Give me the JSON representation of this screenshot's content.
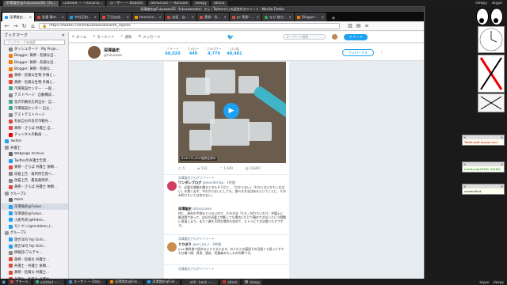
{
  "top_panel": {
    "tasks": [
      "深澤論史@FukuzawaSS（fukuzawasato）さん / Twitter - Mozilla Firefox",
      "untitled — ~/local-b...",
      "ユーザー — Dolphin",
      "tamachan — Konsole",
      "sleepy",
      "atlock"
    ],
    "right_items": [
      "sleepy",
      "skype"
    ]
  },
  "window": {
    "title": "深澤論史@FukuzawaSS（fukuzawasato）さん / Twitterからの返信付きツイート - Mozilla Firefox"
  },
  "tabs": [
    {
      "label": "深澤論史@Fukuza...",
      "color": "#1da1f2",
      "active": true
    },
    {
      "label": "急量 静の道 ...",
      "color": "#e3473a",
      "active": false
    },
    {
      "label": "中村元和@Fuk...",
      "color": "#1da1f2",
      "active": false
    },
    {
      "label": "下谷@成瀬研",
      "color": "#e3473a",
      "active": false
    },
    {
      "label": "tamachanブログ",
      "color": "#ff9900",
      "active": false
    },
    {
      "label": "自転 - 自転ダ...",
      "color": "#e3473a",
      "active": false
    },
    {
      "label": "黄柳 - 危険な...",
      "color": "#e3473a",
      "active": false
    },
    {
      "label": "pc 黄柳 - 危険...",
      "color": "#e3473a",
      "active": false
    },
    {
      "label": "なぜ 能力テスト",
      "color": "#34a853",
      "active": false
    },
    {
      "label": "Blogger: 黄柳...",
      "color": "#f57d00",
      "active": false
    }
  ],
  "navbar": {
    "url": "https://twitter.com/fukuzawasato/with_replies",
    "back": "←",
    "forward": "→",
    "reload": "↻",
    "home": "⌂"
  },
  "sidebar": {
    "title": "ブックマーク",
    "search_placeholder": "ブックマークを検索",
    "items": [
      {
        "label": "ダッシュボード · My Proje...",
        "indent": 2,
        "color": "#888"
      },
      {
        "label": "Blogger: 黄柳 - 危険な自...",
        "indent": 2,
        "color": "#f57d00"
      },
      {
        "label": "Blogger: 黄柳 - 危険な自...",
        "indent": 2,
        "color": "#f57d00"
      },
      {
        "label": "Blogger: 黄柳 - 危険な...",
        "indent": 2,
        "color": "#f57d00"
      },
      {
        "label": "黄柳 - 危険な生物 外傷と...",
        "indent": 2,
        "color": "#e3473a"
      },
      {
        "label": "黄柳 - 危険な生物 外傷と...",
        "indent": 2,
        "color": "#e3473a"
      },
      {
        "label": "市場施設センター · 一般...",
        "indent": 2,
        "color": "#4a8"
      },
      {
        "label": "テストページ · 自動構成...",
        "indent": 2,
        "color": "#888"
      },
      {
        "label": "金沢市観光応用自分 · 自...",
        "indent": 2,
        "color": "#4a8"
      },
      {
        "label": "市場施設センター 自立...",
        "indent": 2,
        "color": "#4a8"
      },
      {
        "label": "テストテストページ",
        "indent": 2,
        "color": "#888"
      },
      {
        "label": "有益自分の金沢市観光...",
        "indent": 2,
        "color": "#e3473a"
      },
      {
        "label": "黄柳 - さらば 弁護士 自...",
        "indent": 2,
        "color": "#e3473a"
      },
      {
        "label": "チャンネルの動画 · ...",
        "indent": 2,
        "color": "#e00"
      },
      {
        "label": "Twitter",
        "indent": 1,
        "color": "#1da1f2"
      },
      {
        "label": "弁護士",
        "indent": 1,
        "color": "#999"
      },
      {
        "label": "Webpage Archive",
        "indent": 2,
        "color": "#666"
      },
      {
        "label": "Twitterの弁護士告発...",
        "indent": 2,
        "color": "#1da1f2"
      },
      {
        "label": "黄柳 - さらば 弁護士 依頼...",
        "indent": 2,
        "color": "#e3473a"
      },
      {
        "label": "改竄上告 · 裁判所告発へ...",
        "indent": 2,
        "color": "#888"
      },
      {
        "label": "改竄上告 · 最高裁判所...",
        "indent": 2,
        "color": "#888"
      },
      {
        "label": "黄柳 - さらば 弁護士 依頼...",
        "indent": 2,
        "color": "#e3473a"
      },
      {
        "label": "グループ2",
        "indent": 1,
        "color": "#999"
      },
      {
        "label": "Atom",
        "indent": 2,
        "color": "#666"
      },
      {
        "label": "深澤論史@Fukuz...",
        "indent": 2,
        "color": "#1da1f2",
        "selected": true
      },
      {
        "label": "深澤論史@Fukuz...",
        "indent": 2,
        "color": "#1da1f2"
      },
      {
        "label": "小倉秀夫(@Hideo...",
        "indent": 2,
        "color": "#1da1f2"
      },
      {
        "label": "モトケン(@motoken_t...",
        "indent": 2,
        "color": "#1da1f2"
      },
      {
        "label": "グループ3",
        "indent": 1,
        "color": "#999"
      },
      {
        "label": "落合洋司 Yoji Ochi...",
        "indent": 2,
        "color": "#1da1f2"
      },
      {
        "label": "落合洋司 Yoji Ochi...",
        "indent": 2,
        "color": "#1da1f2"
      },
      {
        "label": "情報誌/フムテキ...",
        "indent": 2,
        "color": "#888"
      },
      {
        "label": "黄柳 - 危険な 弁護士...",
        "indent": 2,
        "color": "#e3473a"
      },
      {
        "label": "弁護士 - 弁護士 依頼...",
        "indent": 2,
        "color": "#e3473a"
      },
      {
        "label": "黄柳 - 危険な 弁護士...",
        "indent": 2,
        "color": "#e3473a"
      },
      {
        "label": "弁護士 - 危険な 弁護士...",
        "indent": 2,
        "color": "#e3473a"
      }
    ]
  },
  "twitter": {
    "nav": {
      "home": "ホーム",
      "moments": "モーメント",
      "notifications": "通知",
      "messages": "メッセージ",
      "search_placeholder": "キーワード検索",
      "tweet_button": "ツイート"
    },
    "profile": {
      "name": "深澤論史",
      "handle": "@fukuzawa",
      "stats": [
        {
          "label": "ツイート",
          "value": "60,020"
        },
        {
          "label": "フォロー",
          "value": "440"
        },
        {
          "label": "フォロワー",
          "value": "4,779"
        },
        {
          "label": "いいね",
          "value": "40,481"
        }
      ],
      "follow_button": "フォローする"
    },
    "video": {
      "caption": "8:46   270,4243回再生済み"
    },
    "actions": [
      "5",
      "543",
      "1,649",
      "18,897"
    ],
    "tweets": [
      {
        "context": "深澤論史さんがリツイート",
        "name": "ワンダレブログ",
        "handle": "@wonderlog · 1時間",
        "text": "で、必要な情報を贈るときもそうだと、「わからない」「わからないかもしれない」を繋く必ず、今わからないにしても、調べる方法はあるということに、そのを知りたいとは言わない。",
        "avatar_color": "#d04060"
      },
      {
        "context": "",
        "name": "深澤論史",
        "handle": "@fukuzawa",
        "text": "仲に、現在の手続をとらないので、その方法「ただ」知りたいだけ。弁護士に解決策であって、自分が必要と判断しても場合にたどり難のできないという問題に直面しまう。また二者を不用な場合を含めて、ヒトメにて方法書いたオプポス。",
        "avatar_color": "#7a5a40"
      },
      {
        "context": "深澤論史さんがリツイート",
        "name": "うりぼう",
        "handle": "@uri_bo_t · 3時間",
        "text": "Jr.vs 教科書で読めないテとなります。の人びとの裏話その日経くて誤ってすでも分業つ規、費系、望応、完整楽みもしれの判断です。",
        "avatar_color": "#c89050"
      },
      {
        "context": "深澤論史さんがリツイート",
        "name": "",
        "handle": "",
        "text": "",
        "avatar_color": "#888"
      }
    ]
  },
  "notes": [
    {
      "text": "Twilet-add-mysql-ura.t"
    },
    {
      "text": "t-entry-wp2018c 2018/1"
    },
    {
      "text": "screenShot"
    }
  ],
  "bottom_bar": {
    "tasks": [
      {
        "label": "アラーム",
        "color": "#d44"
      },
      {
        "label": "untitled — ...",
        "color": "#4a8"
      },
      {
        "label": "ユーザー — Dolp...",
        "color": "#48c"
      },
      {
        "label": "深澤論史@Fuk...",
        "color": "#f80"
      },
      {
        "label": "深澤論史@Fuk...",
        "color": "#1da1f2"
      },
      {
        "label": "atill : bash — ...",
        "color": "#333"
      },
      {
        "label": "atlock",
        "color": "#c33"
      },
      {
        "label": "sleepy",
        "color": "#888"
      }
    ],
    "right_items": [
      "skype",
      "sleepy"
    ]
  }
}
